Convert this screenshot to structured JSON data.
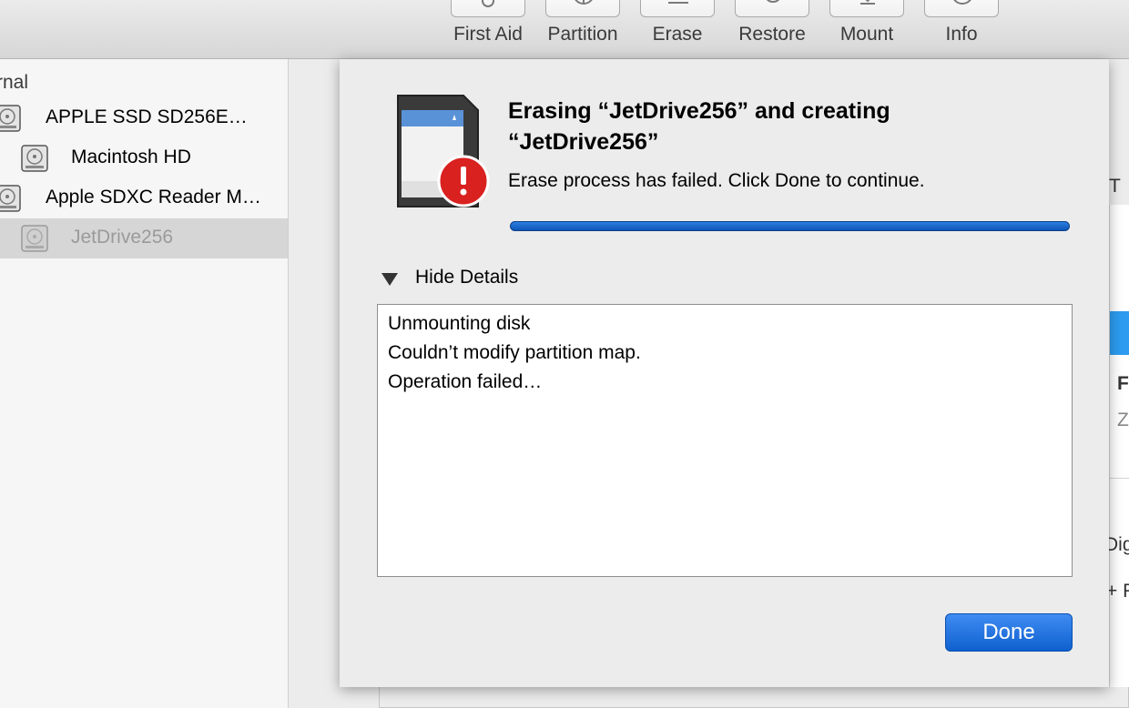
{
  "toolbar": {
    "buttons": [
      {
        "label": "First Aid",
        "icon": "stethoscope-icon"
      },
      {
        "label": "Partition",
        "icon": "pie-chart-icon"
      },
      {
        "label": "Erase",
        "icon": "eraser-icon"
      },
      {
        "label": "Restore",
        "icon": "restore-icon"
      },
      {
        "label": "Mount",
        "icon": "eject-icon"
      },
      {
        "label": "Info",
        "icon": "info-icon"
      }
    ]
  },
  "sidebar": {
    "header": "rnal",
    "items": [
      {
        "label": "APPLE SSD SD256E…",
        "icon": "hard-disk-icon",
        "selected": false
      },
      {
        "label": "Macintosh HD",
        "icon": "volume-icon",
        "selected": false
      },
      {
        "label": "Apple SDXC Reader M…",
        "icon": "hard-disk-icon",
        "selected": false
      },
      {
        "label": "JetDrive256",
        "icon": "volume-icon",
        "selected": true
      }
    ]
  },
  "right_panel": {
    "t1": "T",
    "f": "F",
    "z": "Z",
    "dig": "Dig",
    "plus": "+ F"
  },
  "dialog": {
    "title": "Erasing “JetDrive256” and creating “JetDrive256”",
    "message": "Erase process has failed. Click Done to continue.",
    "progress": 1.0,
    "icon": "sd-card-alert-icon",
    "details_toggle": "Hide Details",
    "log": [
      "Unmounting disk",
      "Couldn’t modify partition map.",
      "Operation failed…"
    ],
    "done_label": "Done"
  },
  "colors": {
    "accent": "#1466d2",
    "alert_red": "#d9211f"
  }
}
